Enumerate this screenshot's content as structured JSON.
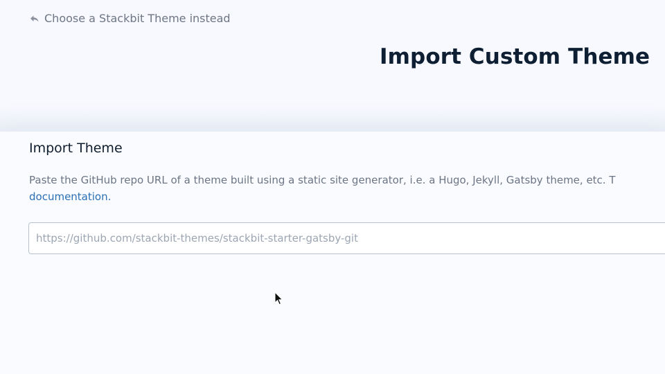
{
  "back_link": {
    "label": "Choose a Stackbit Theme instead",
    "icon": "reply-arrow-icon"
  },
  "page_title": "Import Custom Theme",
  "import_section": {
    "title": "Import Theme",
    "description": "Paste the GitHub repo URL of a theme built using a static site generator, i.e. a Hugo, Jekyll, Gatsby theme, etc. T",
    "documentation_link": "documentation.",
    "repo_input": {
      "value": "",
      "placeholder": "https://github.com/stackbit-themes/stackbit-starter-gatsby-git"
    }
  },
  "colors": {
    "background": "#f7f9fe",
    "heading": "#0f1f33",
    "muted_text": "#6c7584",
    "link": "#2b6fb6",
    "input_border": "#b8c2d1"
  }
}
